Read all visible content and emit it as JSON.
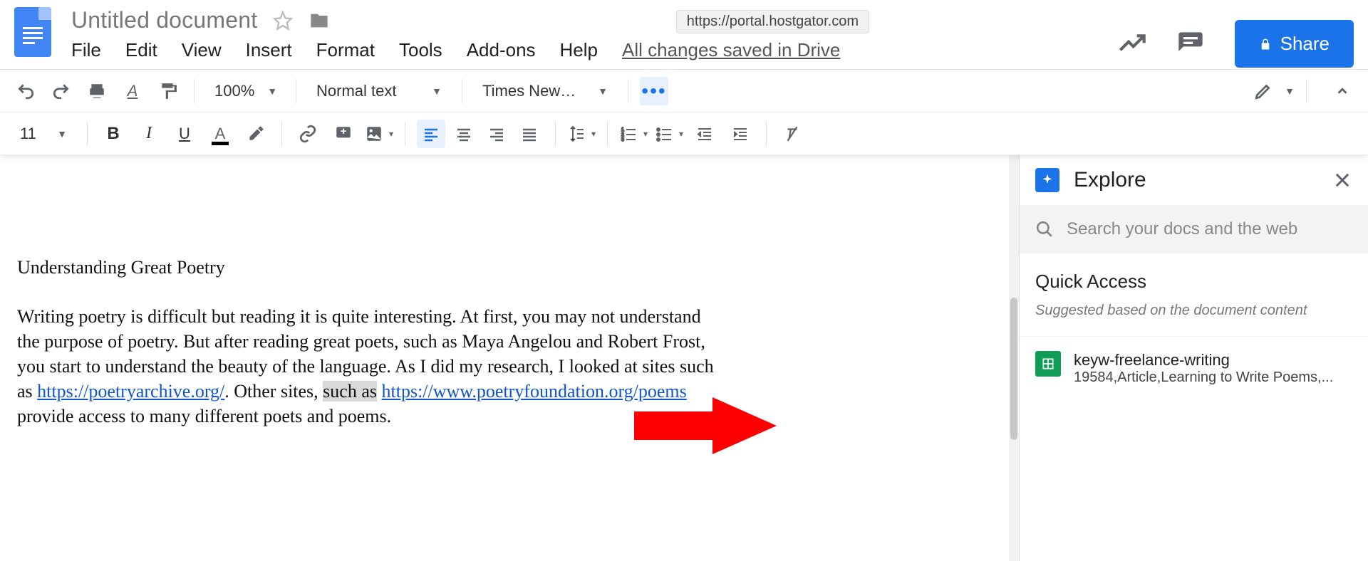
{
  "header": {
    "doc_title": "Untitled document",
    "url_chip": "https://portal.hostgator.com",
    "share_label": "Share"
  },
  "menus": [
    "File",
    "Edit",
    "View",
    "Insert",
    "Format",
    "Tools",
    "Add-ons",
    "Help"
  ],
  "saved_message": "All changes saved in Drive",
  "toolbar": {
    "zoom": "100%",
    "style": "Normal text",
    "font": "Times New…",
    "font_size": "11"
  },
  "document": {
    "title": "Understanding Great Poetry",
    "p_before_link1": "Writing poetry is difficult but reading it is quite interesting. At first, you may not understand the purpose of poetry. But after reading great poets, such as Maya Angelou and Robert Frost, you start to understand the beauty of the language. As I did my research, I looked at sites such as ",
    "link1": "https://poetryarchive.org/",
    "p_middle": ". Other sites, ",
    "sel_text": "such as",
    "space": " ",
    "link2": "https://www.poetryfoundation.org/poems",
    "p_after_link2": " provide access to many different poets and poems."
  },
  "explore": {
    "title": "Explore",
    "search_placeholder": "Search your docs and the web",
    "quick_access_title": "Quick Access",
    "quick_access_sub": "Suggested based on the document content",
    "item": {
      "name": "keyw-freelance-writing",
      "detail": "19584,Article,Learning to Write Poems,..."
    }
  }
}
